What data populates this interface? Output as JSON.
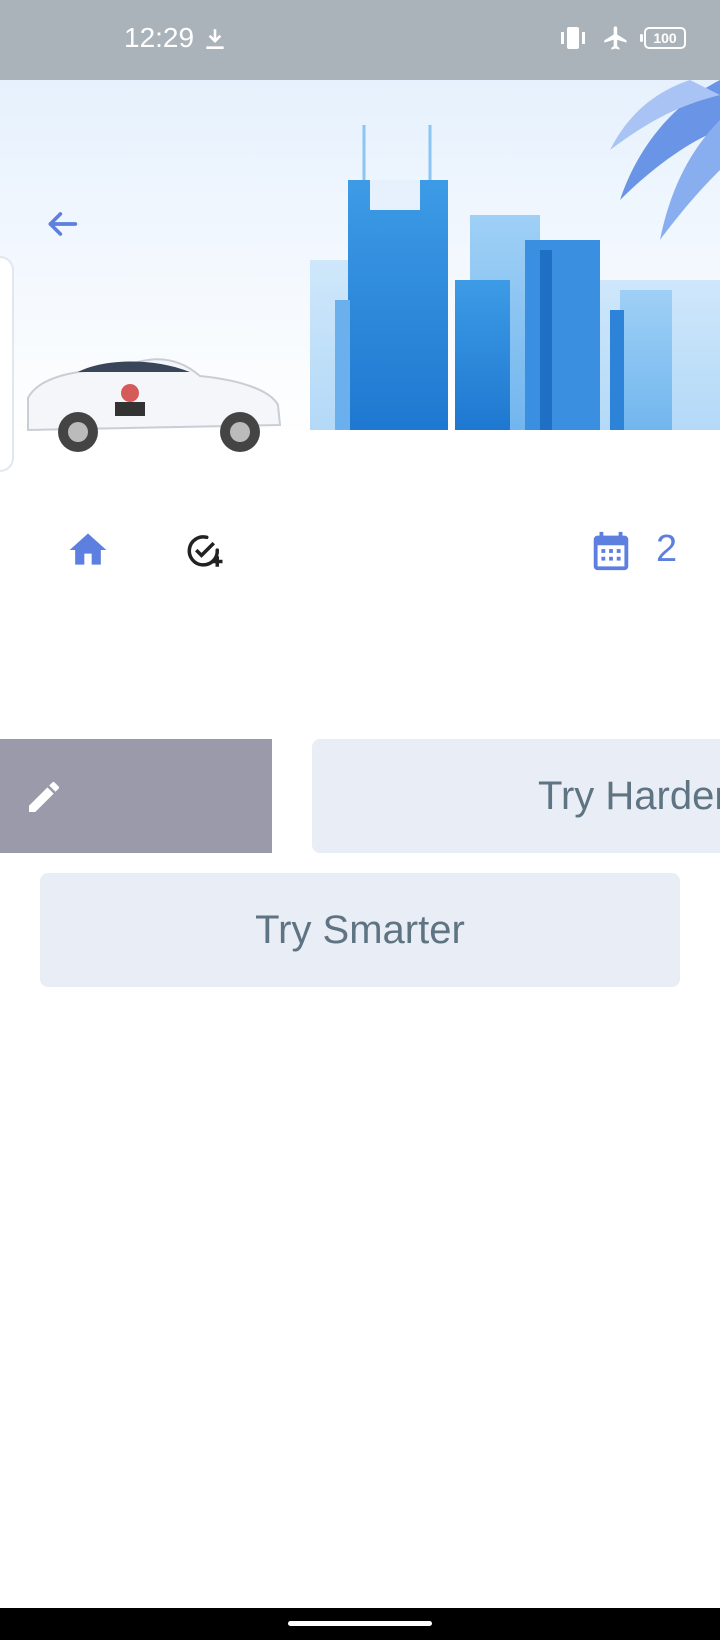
{
  "status_bar": {
    "time": "12:29",
    "icons": [
      "download-icon",
      "vibrate-icon",
      "airplane-mode-icon",
      "battery-icon"
    ],
    "battery": "100"
  },
  "hero": {
    "back_icon": "arrow-left-icon",
    "illustration": "city-skyline-with-car"
  },
  "toolbar": {
    "home_icon": "home-icon",
    "add_task_icon": "check-circle-plus-icon",
    "calendar_icon": "calendar-icon",
    "calendar_count": "2"
  },
  "actions": {
    "edit_icon": "pencil-icon",
    "try_harder": "Try Harder",
    "try_smarter": "Try Smarter"
  },
  "colors": {
    "accent": "#5c7fe0",
    "button_bg": "#e9edf6",
    "button_text": "#5e7482",
    "edit_bg": "#9a9aaa",
    "status_bar_bg": "#abb3ba"
  }
}
